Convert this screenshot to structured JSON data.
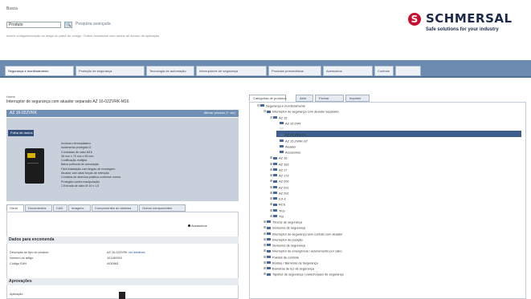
{
  "header": {
    "search_label": "Busca",
    "search_select": "Produto",
    "search_go": "🔍",
    "advanced_search": "Pesquisa avançada",
    "search_hint": "Inserir código/descrição do artigo ou parte do código. Outros resultados com dados de acordo de aplicação",
    "logo_mark": "S",
    "logo_word": "SCHMERSAL",
    "logo_tagline": "Safe solutions for your industry"
  },
  "top_tabs": [
    "Segurança e monitoramento",
    "Proteção de segurança",
    "Tecnologia de automação",
    "Interruptores de segurança",
    "Produtos pneumáticos",
    "Acessórios",
    "Controle"
  ],
  "left": {
    "breadcrumb": "Home",
    "title": "Interruptor de segurança com atuador separado AZ 16-02ZVRK-M16",
    "bar_code": "AZ 16-02ZVRK",
    "bar_show": "Alterar produto (+ ver)",
    "datasheet_label": "Folha de dados",
    "bullets": [
      "Invólucro termoplástico",
      "Isolamento protegido ⊡",
      "3 entradas de cabo M16",
      "36 mm x 75 mm x 55 mm",
      "Codificação múltipla",
      "Baixa potência de comutação",
      "Fácil instalação com ângulo de montagem",
      "Atuador com altas forças de retenção",
      "Contatos de abertura positiva conforme norma",
      "Protegido contra manipulação",
      "1 Entrada de cabo M 16 x 1,5"
    ],
    "detail_tabs": [
      "Geral",
      "Documentos",
      "CAD",
      "Imagens",
      "Componentes do sistema",
      "Outros componentes"
    ],
    "order_link": "Acessórios",
    "sections": {
      "ordering": "Dados para encomenda",
      "application": "Aprovações"
    },
    "ordering_rows": [
      {
        "label": "Descrição do tipo do produto",
        "value": "AZ 16-02ZVRK",
        "link": "ver detalhes",
        "is_link": true
      },
      {
        "label": "Número do artigo",
        "value": "101180953"
      },
      {
        "label": "Código EAN",
        "value": "4030661"
      }
    ],
    "application_row": {
      "label": "Aplicação",
      "value": ""
    }
  },
  "right": {
    "tabs": [
      "Categorias de produtos",
      "Abrir",
      "Fechar",
      "Imprimir"
    ],
    "tree": [
      {
        "indent": 0,
        "toggle": "⊟",
        "label": "Segurança e monitoramento"
      },
      {
        "indent": 1,
        "toggle": "⊟",
        "label": "Interruptor de segurança com atuador separado"
      },
      {
        "indent": 2,
        "toggle": "⊟",
        "label": "AZ 15"
      },
      {
        "indent": 3,
        "toggle": "",
        "label": "AZ 15 ZVR"
      },
      {
        "indent": 3,
        "toggle": "",
        "label": "AZ 15 ZVRK",
        "selected": true
      },
      {
        "indent": 3,
        "toggle": "",
        "label": "AZ 15 ZVR-ST"
      },
      {
        "indent": 3,
        "toggle": "",
        "label": "AZ 15 ZVRK-ST"
      },
      {
        "indent": 3,
        "toggle": "",
        "label": "Atuador"
      },
      {
        "indent": 3,
        "toggle": "",
        "label": "Acessórios"
      },
      {
        "indent": 2,
        "toggle": "⊞",
        "label": "AZ 16"
      },
      {
        "indent": 2,
        "toggle": "⊞",
        "label": "AZ 16Z"
      },
      {
        "indent": 2,
        "toggle": "⊞",
        "label": "AZ 17"
      },
      {
        "indent": 2,
        "toggle": "⊞",
        "label": "AZ 17Z"
      },
      {
        "indent": 2,
        "toggle": "⊞",
        "label": "AZ 200"
      },
      {
        "indent": 2,
        "toggle": "⊞",
        "label": "AZ 201"
      },
      {
        "indent": 2,
        "toggle": "⊞",
        "label": "AZ 202"
      },
      {
        "indent": 2,
        "toggle": "⊞",
        "label": "EX-Z"
      },
      {
        "indent": 2,
        "toggle": "⊞",
        "label": "RCS"
      },
      {
        "indent": 2,
        "toggle": "⊞",
        "label": "TKS"
      },
      {
        "indent": 2,
        "toggle": "⊞",
        "label": "TSI"
      },
      {
        "indent": 1,
        "toggle": "⊞",
        "label": "Trincos de segurança"
      },
      {
        "indent": 1,
        "toggle": "⊞",
        "label": "Sensores de segurança"
      },
      {
        "indent": 1,
        "toggle": "⊞",
        "label": "Interruptor de segurança sem contato com atuador"
      },
      {
        "indent": 1,
        "toggle": "⊞",
        "label": "Interruptor de posição"
      },
      {
        "indent": 1,
        "toggle": "⊞",
        "label": "Sensores de segurança"
      },
      {
        "indent": 1,
        "toggle": "⊞",
        "label": "Interruptor de emergência / acionamento por cabo"
      },
      {
        "indent": 1,
        "toggle": "⊞",
        "label": "Painéis de controle"
      },
      {
        "indent": 1,
        "toggle": "⊞",
        "label": "Bordas / Barreiras de Segurança"
      },
      {
        "indent": 1,
        "toggle": "⊞",
        "label": "Barreiras de luz de segurança"
      },
      {
        "indent": 1,
        "toggle": "⊞",
        "label": "Tapetes de segurança / parachoques de segurança"
      }
    ]
  }
}
